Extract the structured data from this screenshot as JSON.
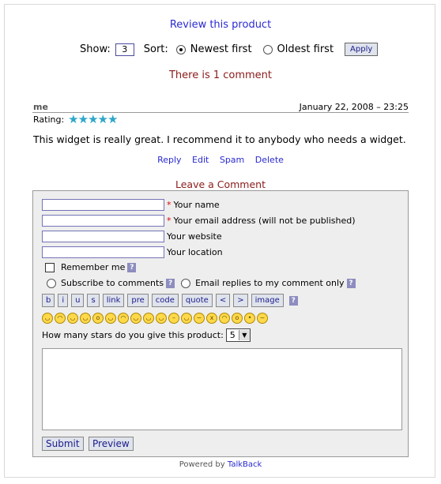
{
  "review_link": "Review this product",
  "controls": {
    "show_label": "Show:",
    "show_value": "3",
    "sort_label": "Sort:",
    "sort_options": [
      "Newest first",
      "Oldest first"
    ],
    "apply_label": "Apply"
  },
  "comment_count_text": "There is 1 comment",
  "comment": {
    "author": "me",
    "date": "January 22, 2008 – 23:25",
    "rating_label": "Rating:",
    "rating_value": 5,
    "body": "This widget is really great. I recommend it to anybody who needs a widget.",
    "actions": [
      "Reply",
      "Edit",
      "Spam",
      "Delete"
    ]
  },
  "form": {
    "title": "Leave a Comment",
    "name_label": "Your name",
    "email_label": "Your email address (will not be published)",
    "website_label": "Your website",
    "location_label": "Your location",
    "remember_label": "Remember me",
    "subscribe_label": "Subscribe to comments",
    "email_replies_label": "Email replies to my comment only",
    "help_glyph": "?",
    "format_buttons": [
      "b",
      "i",
      "u",
      "s",
      "link",
      "pre",
      "code",
      "quote",
      "<",
      ">",
      "image"
    ],
    "stars_question": "How many stars do you give this product:",
    "stars_selected": "5",
    "submit_label": "Submit",
    "preview_label": "Preview"
  },
  "footer": {
    "powered_text": "Powered by",
    "powered_link": "TalkBack"
  },
  "colors": {
    "link": "#2a2ad0",
    "header_red": "#8b1a1a",
    "star": "#2ea6c8"
  }
}
